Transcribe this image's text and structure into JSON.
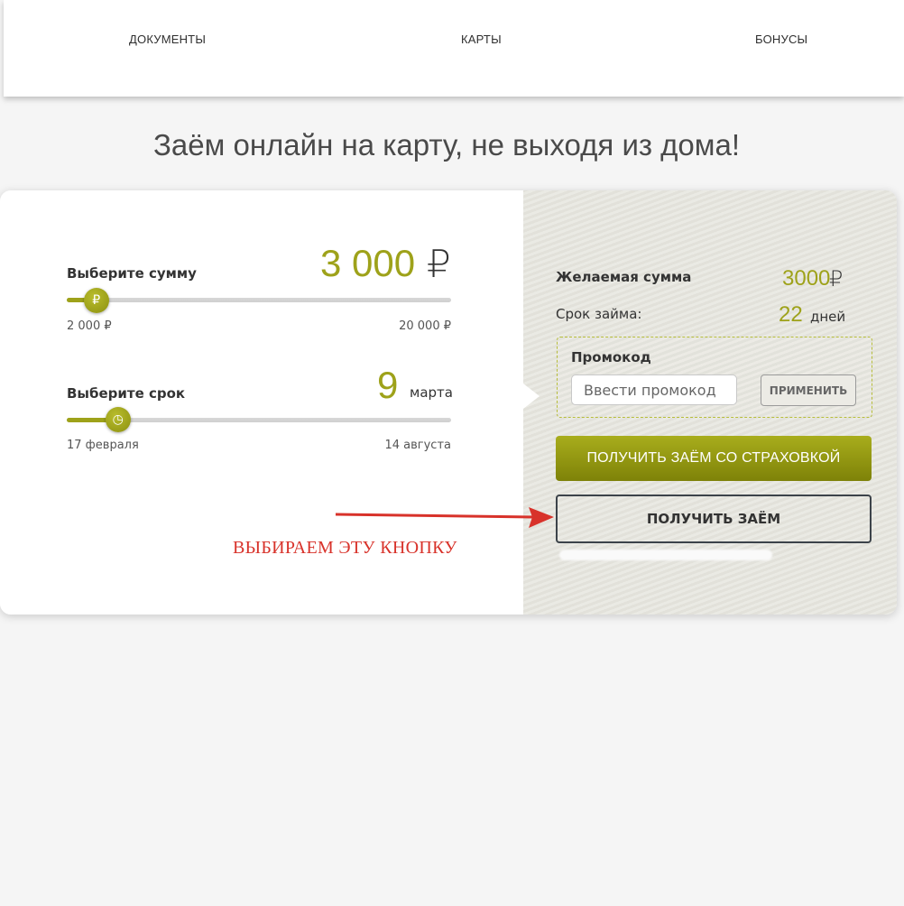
{
  "nav": {
    "items": [
      {
        "label": "ДОКУМЕНТЫ"
      },
      {
        "label": "КАРТЫ"
      },
      {
        "label": "БОНУСЫ"
      }
    ]
  },
  "headline": "Заём онлайн на карту, не выходя из дома!",
  "calculator": {
    "amount": {
      "label": "Выберите сумму",
      "value": "3 000",
      "currency": "₽",
      "min": "2 000 ₽",
      "max": "20 000 ₽",
      "thumb_icon": "ruble-icon",
      "thumb_glyph": "₽",
      "fraction": 0.056
    },
    "term": {
      "label": "Выберите срок",
      "value": "9",
      "month": "марта",
      "min": "17 февраля",
      "max": "14 августа",
      "thumb_icon": "clock-icon",
      "thumb_glyph": "◷",
      "fraction": 0.115
    }
  },
  "summary": {
    "sum_label": "Желаемая сумма",
    "sum_value": "3000",
    "sum_currency": "₽",
    "term_label": "Срок займа:",
    "term_value": "22",
    "term_unit": "дней"
  },
  "promo": {
    "title": "Промокод",
    "placeholder": "Ввести промокод",
    "apply_label": "ПРИМЕНИТЬ"
  },
  "buttons": {
    "insurance_label": "ПОЛУЧИТЬ ЗАЁМ СО СТРАХОВКОЙ",
    "loan_label": "ПОЛУЧИТЬ ЗАЁМ"
  },
  "annotation": "ВЫБИРАЕМ ЭТУ КНОПКУ",
  "colors": {
    "accent": "#9ea21a",
    "annotation": "#d8322a",
    "panel_bg": "#e6e5de"
  }
}
